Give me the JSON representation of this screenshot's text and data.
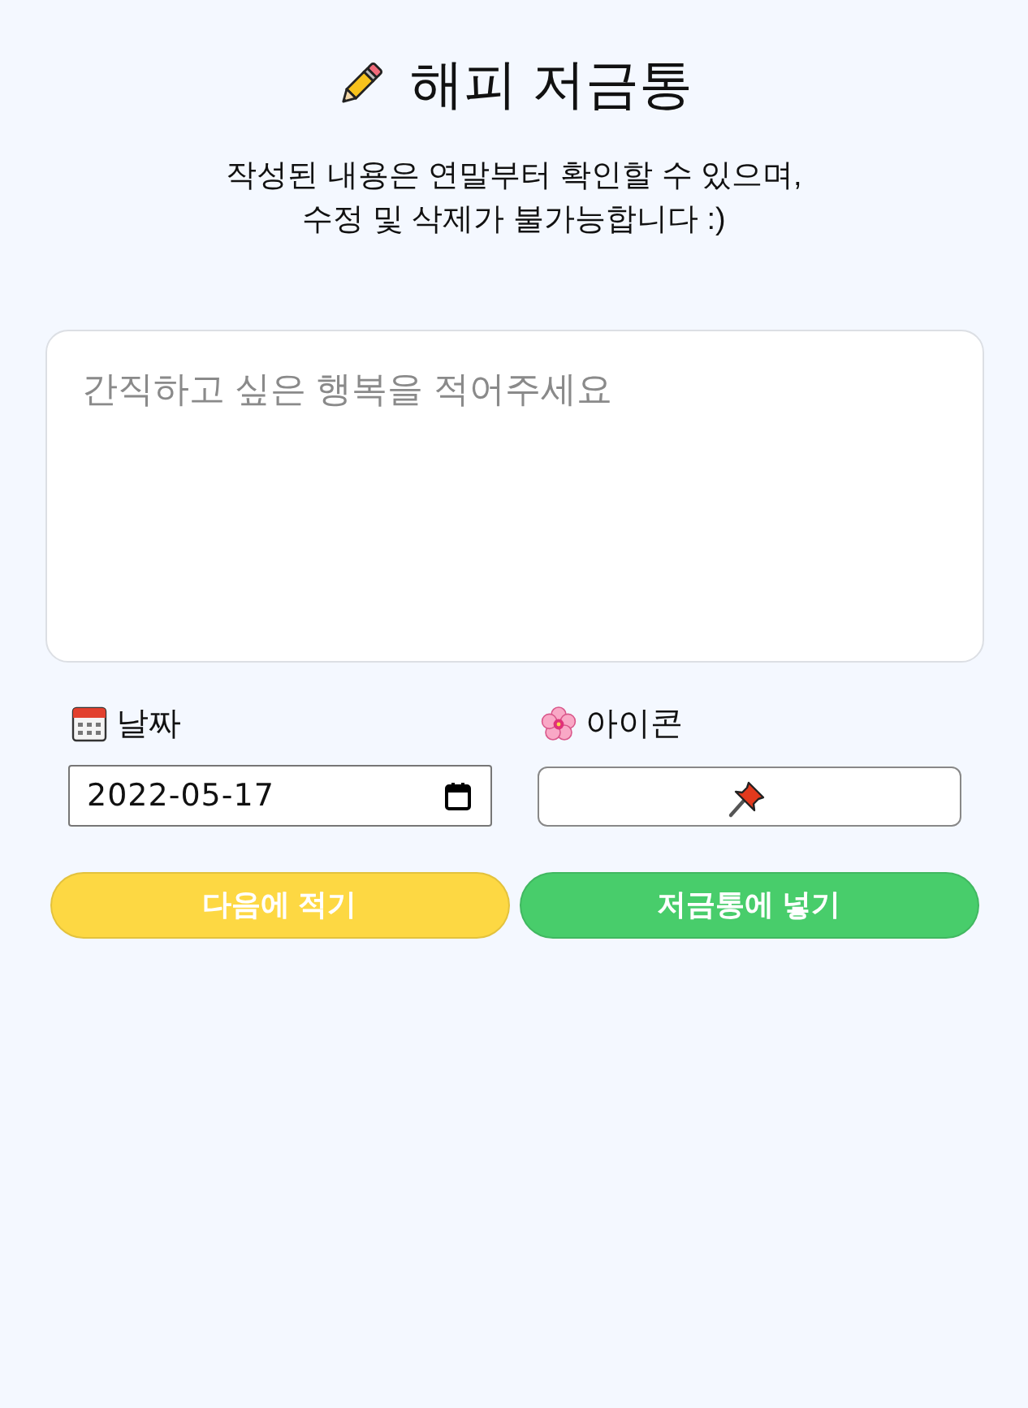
{
  "header": {
    "title": "해피 저금통",
    "subtitle": "작성된 내용은 연말부터 확인할 수 있으며,\n수정 및 삭제가 불가능합니다 :)"
  },
  "entry": {
    "placeholder": "간직하고 싶은 행복을 적어주세요"
  },
  "fields": [
    {
      "kind": "date",
      "label": "날짜",
      "value": "2022-05-17"
    },
    {
      "kind": "icon",
      "label": "아이콘"
    }
  ],
  "buttons": [
    {
      "label": "다음에 적기",
      "color": "#fdd843"
    },
    {
      "label": "저금통에 넣기",
      "color": "#48cd6b"
    }
  ]
}
